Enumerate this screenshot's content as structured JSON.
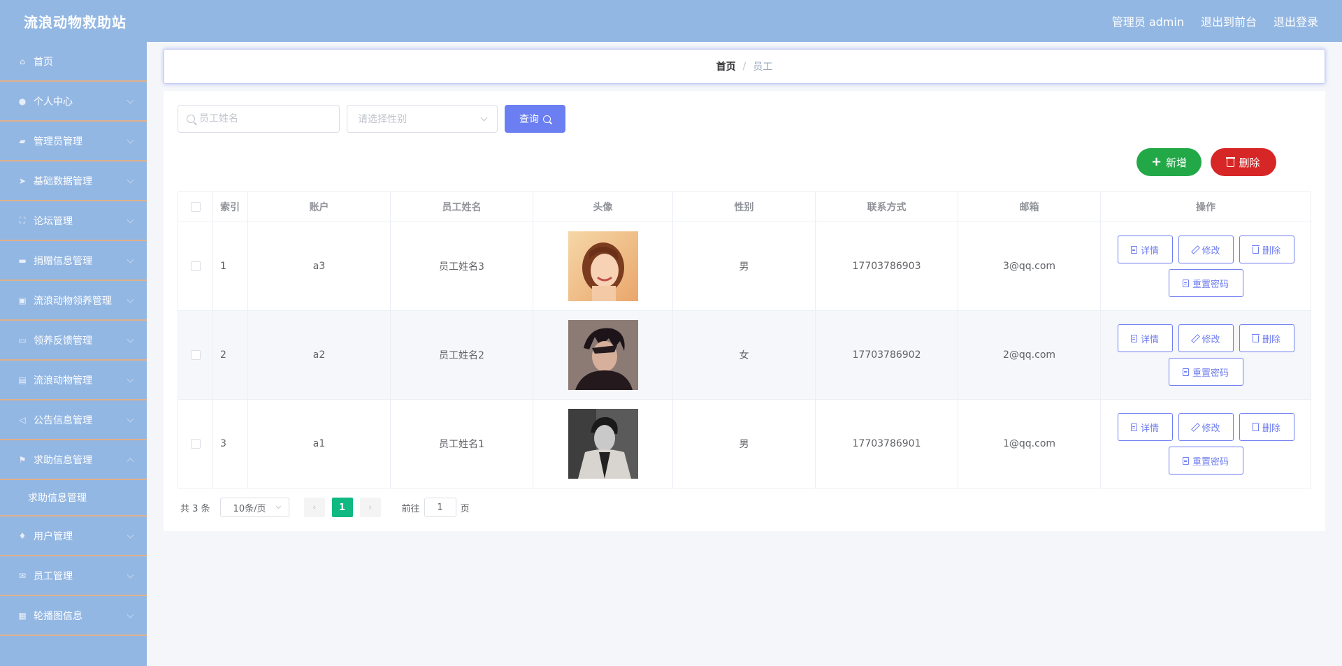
{
  "header": {
    "brand": "流浪动物救助站",
    "admin_label": "管理员 admin",
    "to_frontend": "退出到前台",
    "logout": "退出登录"
  },
  "sidebar": {
    "items": [
      {
        "label": "首页",
        "icon": "home-icon",
        "has_chevron": false
      },
      {
        "label": "个人中心",
        "icon": "user-icon",
        "has_chevron": true
      },
      {
        "label": "管理员管理",
        "icon": "tools-icon",
        "has_chevron": true
      },
      {
        "label": "基础数据管理",
        "icon": "send-icon",
        "has_chevron": true
      },
      {
        "label": "论坛管理",
        "icon": "fullscreen-icon",
        "has_chevron": true
      },
      {
        "label": "捐赠信息管理",
        "icon": "card-icon",
        "has_chevron": true
      },
      {
        "label": "流浪动物领养管理",
        "icon": "briefcase-icon",
        "has_chevron": true
      },
      {
        "label": "领养反馈管理",
        "icon": "monitor-icon",
        "has_chevron": true
      },
      {
        "label": "流浪动物管理",
        "icon": "document-icon",
        "has_chevron": true
      },
      {
        "label": "公告信息管理",
        "icon": "location-icon",
        "has_chevron": true
      },
      {
        "label": "求助信息管理",
        "icon": "flag-icon",
        "has_chevron": true,
        "expanded": true
      },
      {
        "label": "求助信息管理",
        "icon": "",
        "sub": true
      },
      {
        "label": "用户管理",
        "icon": "microphone-icon",
        "has_chevron": true
      },
      {
        "label": "员工管理",
        "icon": "message-icon",
        "has_chevron": true
      },
      {
        "label": "轮播图信息",
        "icon": "clipboard-icon",
        "has_chevron": true
      }
    ]
  },
  "breadcrumb": {
    "home": "首页",
    "separator": "/",
    "current": "员工"
  },
  "search": {
    "name_placeholder": "员工姓名",
    "gender_placeholder": "请选择性别",
    "query_label": "查询"
  },
  "actions": {
    "add_label": "新增",
    "delete_label": "删除"
  },
  "table": {
    "headers": [
      "索引",
      "账户",
      "员工姓名",
      "头像",
      "性别",
      "联系方式",
      "邮箱",
      "操作"
    ],
    "rows": [
      {
        "index": "1",
        "account": "a3",
        "name": "员工姓名3",
        "avatar": "woman-portrait",
        "gender": "男",
        "phone": "17703786903",
        "email": "3@qq.com"
      },
      {
        "index": "2",
        "account": "a2",
        "name": "员工姓名2",
        "avatar": "man-portrait-dark",
        "gender": "女",
        "phone": "17703786902",
        "email": "2@qq.com"
      },
      {
        "index": "3",
        "account": "a1",
        "name": "员工姓名1",
        "avatar": "man-portrait-bw",
        "gender": "男",
        "phone": "17703786901",
        "email": "1@qq.com"
      }
    ],
    "row_actions": {
      "detail": "详情",
      "edit": "修改",
      "delete": "删除",
      "reset_pwd": "重置密码"
    }
  },
  "pagination": {
    "total": "共 3 条",
    "page_size": "10条/页",
    "current_page": "1",
    "goto_prefix": "前往",
    "goto_value": "1",
    "goto_suffix": "页"
  },
  "colors": {
    "header_bg": "#93b7e3",
    "sidebar_bg": "#93b7e3",
    "sidebar_divider": "#e0b08a",
    "primary": "#6b7ff2",
    "add_green": "#23a848",
    "delete_red": "#d72626",
    "page_active": "#10b981"
  }
}
